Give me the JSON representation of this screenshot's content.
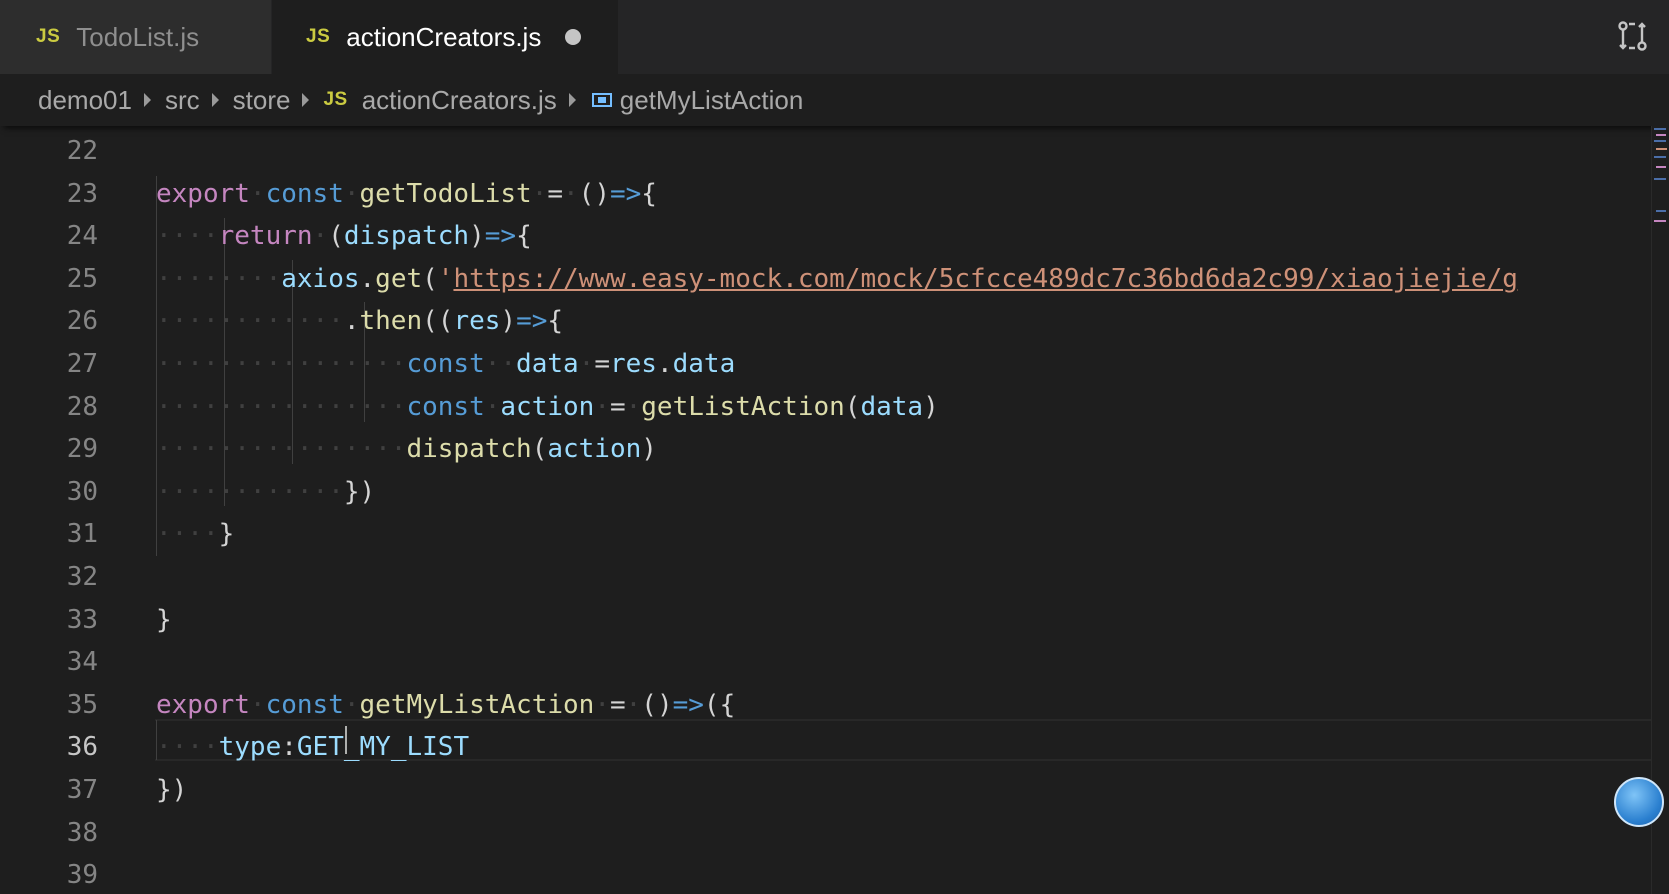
{
  "tabs": [
    {
      "badge": "JS",
      "label": "TodoList.js",
      "active": false
    },
    {
      "badge": "JS",
      "label": "actionCreators.js",
      "active": true,
      "dirty": true
    }
  ],
  "tab_actions": {
    "icon": "source-control-compare-icon"
  },
  "breadcrumb": {
    "items": [
      "demo01",
      "src",
      "store"
    ],
    "file_badge": "JS",
    "file": "actionCreators.js",
    "symbol_icon": "symbol-variable-icon",
    "symbol": "getMyListAction"
  },
  "editor": {
    "line_numbers": [
      "22",
      "23",
      "24",
      "25",
      "26",
      "27",
      "28",
      "29",
      "30",
      "31",
      "32",
      "33",
      "34",
      "35",
      "36",
      "37",
      "38",
      "39"
    ],
    "current_line": "36",
    "lines": [
      {
        "ws": "",
        "tokens": []
      },
      {
        "ws": "",
        "tokens": [
          [
            "kw",
            "export"
          ],
          [
            "ws",
            "·"
          ],
          [
            "st",
            "const"
          ],
          [
            "ws",
            "·"
          ],
          [
            "fn",
            "getTodoList"
          ],
          [
            "ws",
            "·"
          ],
          [
            "pu",
            "="
          ],
          [
            "ws",
            "·"
          ],
          [
            "pu",
            "()"
          ],
          [
            "ar",
            "=>"
          ],
          [
            "pu",
            "{"
          ]
        ]
      },
      {
        "ws": "····",
        "tokens": [
          [
            "kw",
            "return"
          ],
          [
            "ws",
            "·"
          ],
          [
            "pu",
            "("
          ],
          [
            "vr",
            "dispatch"
          ],
          [
            "pu",
            ")"
          ],
          [
            "ar",
            "=>"
          ],
          [
            "pu",
            "{"
          ]
        ]
      },
      {
        "ws": "········",
        "tokens": [
          [
            "vr",
            "axios"
          ],
          [
            "pu",
            "."
          ],
          [
            "fn",
            "get"
          ],
          [
            "pu",
            "("
          ],
          [
            "str",
            "'"
          ],
          [
            "url",
            "https://www.easy-mock.com/mock/5cfcce489dc7c36bd6da2c99/xiaojiejie/g"
          ]
        ]
      },
      {
        "ws": "············",
        "tokens": [
          [
            "pu",
            "."
          ],
          [
            "fn",
            "then"
          ],
          [
            "pu",
            "(("
          ],
          [
            "vr",
            "res"
          ],
          [
            "pu",
            ")"
          ],
          [
            "ar",
            "=>"
          ],
          [
            "pu",
            "{"
          ]
        ]
      },
      {
        "ws": "················",
        "tokens": [
          [
            "st",
            "const"
          ],
          [
            "ws",
            "··"
          ],
          [
            "vr",
            "data"
          ],
          [
            "ws",
            "·"
          ],
          [
            "pu",
            "="
          ],
          [
            "vr",
            "res"
          ],
          [
            "pu",
            "."
          ],
          [
            "vr",
            "data"
          ]
        ]
      },
      {
        "ws": "················",
        "tokens": [
          [
            "st",
            "const"
          ],
          [
            "ws",
            "·"
          ],
          [
            "vr",
            "action"
          ],
          [
            "ws",
            "·"
          ],
          [
            "pu",
            "="
          ],
          [
            "ws",
            "·"
          ],
          [
            "fn",
            "getListAction"
          ],
          [
            "pu",
            "("
          ],
          [
            "vr",
            "data"
          ],
          [
            "pu",
            ")"
          ]
        ]
      },
      {
        "ws": "················",
        "tokens": [
          [
            "fn",
            "dispatch"
          ],
          [
            "pu",
            "("
          ],
          [
            "vr",
            "action"
          ],
          [
            "pu",
            ")"
          ]
        ]
      },
      {
        "ws": "············",
        "tokens": [
          [
            "pu",
            "})"
          ]
        ]
      },
      {
        "ws": "····",
        "tokens": [
          [
            "pu",
            "}"
          ]
        ]
      },
      {
        "ws": "",
        "tokens": []
      },
      {
        "ws": "",
        "tokens": [
          [
            "pu",
            "}"
          ]
        ]
      },
      {
        "ws": "",
        "tokens": []
      },
      {
        "ws": "",
        "tokens": [
          [
            "kw",
            "export"
          ],
          [
            "ws",
            "·"
          ],
          [
            "st",
            "const"
          ],
          [
            "ws",
            "·"
          ],
          [
            "fn",
            "getMyListAction"
          ],
          [
            "ws",
            "·"
          ],
          [
            "pu",
            "="
          ],
          [
            "ws",
            "·"
          ],
          [
            "pu",
            "()"
          ],
          [
            "ar",
            "=>"
          ],
          [
            "pu",
            "({"
          ]
        ]
      },
      {
        "ws": "····",
        "tokens": [
          [
            "vr",
            "type"
          ],
          [
            "pu",
            ":"
          ],
          [
            "vr",
            "GET_MY_LIST"
          ]
        ]
      },
      {
        "ws": "",
        "tokens": [
          [
            "pu",
            "})"
          ]
        ]
      },
      {
        "ws": "",
        "tokens": []
      },
      {
        "ws": "",
        "tokens": []
      }
    ]
  },
  "colors": {
    "keyword": "#c586c0",
    "storage": "#569cd6",
    "function": "#dcdcaa",
    "variable": "#9cdcfe",
    "string": "#ce9178",
    "badge": "#cbcb41"
  },
  "floating_button": {
    "icon": "assistant-bubble-icon"
  }
}
